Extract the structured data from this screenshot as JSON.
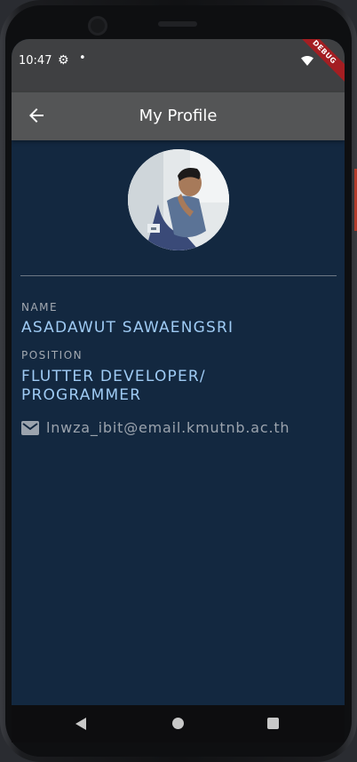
{
  "status_bar": {
    "time": "10:47",
    "settings_icon": "gear-icon",
    "dot": "•",
    "debug_banner": "DEBUG"
  },
  "app_bar": {
    "title": "My Profile",
    "back_icon": "arrow-back-icon"
  },
  "profile": {
    "name_label": "NAME",
    "name": "ASADAWUT SAWAENGSRI",
    "position_label": "POSITION",
    "position_line1": "FLUTTER DEVELOPER/",
    "position_line2": "PROGRAMMER",
    "email_icon": "mail-icon",
    "email": "lnwza_ibit@email.kmutnb.ac.th"
  },
  "colors": {
    "background": "#132840",
    "app_bar": "#545556",
    "accent_text": "#9fcbf4",
    "debug": "#a41e22"
  }
}
